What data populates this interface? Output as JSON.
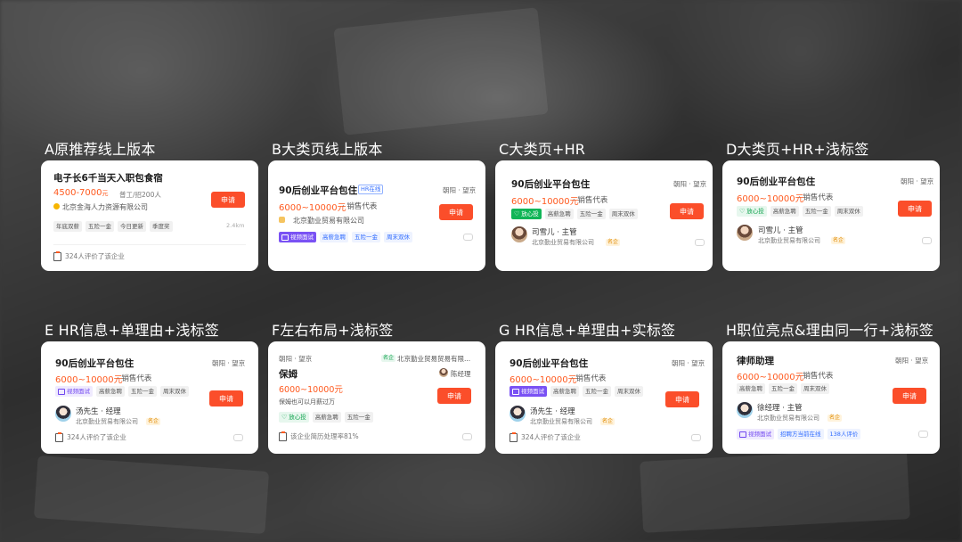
{
  "A": {
    "title": "A原推荐线上版本",
    "job": "电子长6千当天入职包食宿",
    "salary": "4500-7000",
    "salary_unit": "元",
    "meta": "普工/招200人",
    "company": "北京金海人力资源有限公司",
    "tags": [
      "年底双薪",
      "五险一金",
      "今日更新",
      "季度奖"
    ],
    "distance": "2.4km",
    "reviews": "324人评价了该企业",
    "apply": "申请"
  },
  "B": {
    "title": "B大类页线上版本",
    "job": "90后创业平台包住",
    "hr_online": "HR在线",
    "location": "朝阳 · 望京",
    "salary": "6000~10000元",
    "position": "· 销售代表",
    "company": "北京勤业贸易有限公司",
    "tags": [
      "视频面试",
      "高薪急聘",
      "五险一金",
      "周末双休"
    ],
    "apply": "申请"
  },
  "C": {
    "title": "C大类页+HR",
    "job": "90后创业平台包住",
    "location": "朝阳 · 望京",
    "salary": "6000~10000元",
    "position": "· 销售代表",
    "tags": [
      "放心投",
      "高薪急聘",
      "五险一金",
      "周末双休"
    ],
    "hr_name": "司雪儿 · 主管",
    "company": "北京勤业贸易有限公司",
    "badge": "名企",
    "apply": "申请"
  },
  "D": {
    "title": "D大类页+HR+浅标签",
    "job": "90后创业平台包住",
    "location": "朝阳 · 望京",
    "salary": "6000~10000元",
    "position": "· 销售代表",
    "tags": [
      "放心投",
      "高薪急聘",
      "五险一金",
      "周末双休"
    ],
    "hr_name": "司雪儿 · 主管",
    "company": "北京勤业贸易有限公司",
    "badge": "名企",
    "apply": "申请"
  },
  "E": {
    "title": "E HR信息+单理由+浅标签",
    "job": "90后创业平台包住",
    "location": "朝阳 · 望京",
    "salary": "6000~10000元",
    "position": "· 销售代表",
    "tags": [
      "视频面试",
      "高薪急聘",
      "五险一金",
      "周末双休"
    ],
    "hr_name": "汤先生 · 经理",
    "company": "北京勤业贸易有限公司",
    "badge": "名企",
    "reviews": "324人评价了该企业",
    "apply": "申请"
  },
  "F": {
    "title": "F左右布局+浅标签",
    "location": "朝阳 · 望京",
    "comp_badge": "名企",
    "company": "北京勤业贸易贸易有限...",
    "job": "保姆",
    "hr_name": "陈经理",
    "salary": "6000~10000元",
    "desc": "保姆也可以月薪过万",
    "tags": [
      "放心投",
      "高薪急聘",
      "五险一金"
    ],
    "rate": "该企业简历处理率81%",
    "apply": "申请"
  },
  "G": {
    "title": "G HR信息+单理由+实标签",
    "job": "90后创业平台包住",
    "location": "朝阳 · 望京",
    "salary": "6000~10000元",
    "position": "· 销售代表",
    "tags": [
      "视频面试",
      "高薪急聘",
      "五险一金",
      "周末双休"
    ],
    "hr_name": "汤先生 · 经理",
    "company": "北京勤业贸易有限公司",
    "badge": "名企",
    "reviews": "324人评价了该企业",
    "apply": "申请"
  },
  "H": {
    "title": "H职位亮点&理由同一行+浅标签",
    "job": "律师助理",
    "location": "朝阳 · 望京",
    "salary": "6000~10000元",
    "position": "· 销售代表",
    "tags": [
      "高薪急聘",
      "五险一金",
      "周末双休"
    ],
    "hr_name": "徐经理 · 主管",
    "company": "北京勤业贸易有限公司",
    "badge": "名企",
    "bottom_tags": [
      "视频面试",
      "招聘方当前在线",
      "138人评价"
    ],
    "apply": "申请"
  },
  "colors": {
    "accent": "#fb4e2a",
    "salary": "#ff5a1f",
    "video": "#7a52f4",
    "green": "#10b557"
  }
}
